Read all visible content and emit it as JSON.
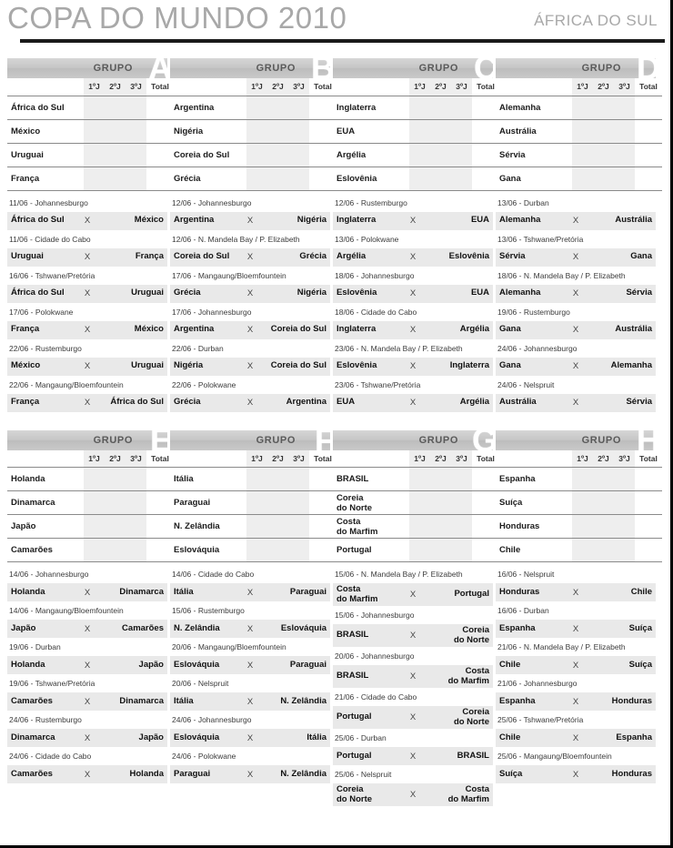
{
  "header": {
    "title": "COPA DO MUNDO 2010",
    "subtitle": "ÁFRICA DO SUL"
  },
  "labels": {
    "grupo": "GRUPO",
    "vs": "X",
    "columns": [
      "1ºJ",
      "2ºJ",
      "3ºJ",
      "Total"
    ]
  },
  "groups": [
    {
      "letter": "A",
      "teams": [
        "África do Sul",
        "México",
        "Uruguai",
        "França"
      ],
      "matches": [
        {
          "venue": "11/06 - Johannesburgo",
          "home": "África do Sul",
          "away": "México"
        },
        {
          "venue": "11/06 - Cidade do Cabo",
          "home": "Uruguai",
          "away": "França"
        },
        {
          "venue": "16/06 - Tshwane/Pretória",
          "home": "África do Sul",
          "away": "Uruguai"
        },
        {
          "venue": "17/06 - Polokwane",
          "home": "França",
          "away": "México"
        },
        {
          "venue": "22/06 - Rustemburgo",
          "home": "México",
          "away": "Uruguai"
        },
        {
          "venue": "22/06 - Mangaung/Bloemfountein",
          "home": "França",
          "away": "África do Sul"
        }
      ]
    },
    {
      "letter": "B",
      "teams": [
        "Argentina",
        "Nigéria",
        "Coreia do Sul",
        "Grécia"
      ],
      "matches": [
        {
          "venue": "12/06 - Johannesburgo",
          "home": "Argentina",
          "away": "Nigéria"
        },
        {
          "venue": "12/06 - N. Mandela Bay / P. Elizabeth",
          "home": "Coreia do Sul",
          "away": "Grécia"
        },
        {
          "venue": "17/06 - Mangaung/Bloemfountein",
          "home": "Grécia",
          "away": "Nigéria"
        },
        {
          "venue": "17/06 - Johannesburgo",
          "home": "Argentina",
          "away": "Coreia do Sul"
        },
        {
          "venue": "22/06 - Durban",
          "home": "Nigéria",
          "away": "Coreia do Sul"
        },
        {
          "venue": "22/06 - Polokwane",
          "home": "Grécia",
          "away": "Argentina"
        }
      ]
    },
    {
      "letter": "C",
      "teams": [
        "Inglaterra",
        "EUA",
        "Argélia",
        "Eslovênia"
      ],
      "matches": [
        {
          "venue": "12/06 - Rustemburgo",
          "home": "Inglaterra",
          "away": "EUA"
        },
        {
          "venue": "13/06 - Polokwane",
          "home": "Argélia",
          "away": "Eslovênia"
        },
        {
          "venue": "18/06 - Johannesburgo",
          "home": "Eslovênia",
          "away": "EUA"
        },
        {
          "venue": "18/06 - Cidade do Cabo",
          "home": "Inglaterra",
          "away": "Argélia"
        },
        {
          "venue": "23/06 - N. Mandela Bay / P. Elizabeth",
          "home": "Eslovênia",
          "away": "Inglaterra"
        },
        {
          "venue": "23/06 - Tshwane/Pretória",
          "home": "EUA",
          "away": "Argélia"
        }
      ]
    },
    {
      "letter": "D",
      "teams": [
        "Alemanha",
        "Austrália",
        "Sérvia",
        "Gana"
      ],
      "matches": [
        {
          "venue": "13/06 - Durban",
          "home": "Alemanha",
          "away": "Austrália"
        },
        {
          "venue": "13/06 - Tshwane/Pretória",
          "home": "Sérvia",
          "away": "Gana"
        },
        {
          "venue": "18/06 - N. Mandela Bay / P. Elizabeth",
          "home": "Alemanha",
          "away": "Sérvia"
        },
        {
          "venue": "19/06 - Rustemburgo",
          "home": "Gana",
          "away": "Austrália"
        },
        {
          "venue": "24/06 - Johannesburgo",
          "home": "Gana",
          "away": "Alemanha"
        },
        {
          "venue": "24/06 - Nelspruit",
          "home": "Austrália",
          "away": "Sérvia"
        }
      ]
    },
    {
      "letter": "E",
      "teams": [
        "Holanda",
        "Dinamarca",
        "Japão",
        "Camarões"
      ],
      "matches": [
        {
          "venue": "14/06 - Johannesburgo",
          "home": "Holanda",
          "away": "Dinamarca"
        },
        {
          "venue": "14/06 - Mangaung/Bloemfountein",
          "home": "Japão",
          "away": "Camarões"
        },
        {
          "venue": "19/06 - Durban",
          "home": "Holanda",
          "away": "Japão"
        },
        {
          "venue": "19/06 - Tshwane/Pretória",
          "home": "Camarões",
          "away": "Dinamarca"
        },
        {
          "venue": "24/06 - Rustemburgo",
          "home": "Dinamarca",
          "away": "Japão"
        },
        {
          "venue": "24/06 - Cidade do Cabo",
          "home": "Camarões",
          "away": "Holanda"
        }
      ]
    },
    {
      "letter": "F",
      "teams": [
        "Itália",
        "Paraguai",
        "N. Zelândia",
        "Eslováquia"
      ],
      "matches": [
        {
          "venue": "14/06 - Cidade do Cabo",
          "home": "Itália",
          "away": "Paraguai"
        },
        {
          "venue": "15/06 - Rustemburgo",
          "home": "N. Zelândia",
          "away": "Eslováquia"
        },
        {
          "venue": "20/06 - Mangaung/Bloemfountein",
          "home": "Eslováquia",
          "away": "Paraguai"
        },
        {
          "venue": "20/06 - Nelspruit",
          "home": "Itália",
          "away": "N. Zelândia"
        },
        {
          "venue": "24/06 - Johannesburgo",
          "home": "Eslováquia",
          "away": "Itália"
        },
        {
          "venue": "24/06 - Polokwane",
          "home": "Paraguai",
          "away": "N. Zelândia"
        }
      ]
    },
    {
      "letter": "G",
      "teams": [
        "BRASIL",
        "Coreia\ndo Norte",
        "Costa\ndo Marfim",
        "Portugal"
      ],
      "matches": [
        {
          "venue": "15/06 - N. Mandela Bay / P. Elizabeth",
          "home": "Costa\ndo Marfim",
          "away": "Portugal"
        },
        {
          "venue": "15/06 - Johannesburgo",
          "home": "BRASIL",
          "away": "Coreia\ndo Norte"
        },
        {
          "venue": "20/06 - Johannesburgo",
          "home": "BRASIL",
          "away": "Costa\ndo Marfim"
        },
        {
          "venue": "21/06 - Cidade do Cabo",
          "home": "Portugal",
          "away": "Coreia\ndo Norte"
        },
        {
          "venue": "25/06 - Durban",
          "home": "Portugal",
          "away": "BRASIL"
        },
        {
          "venue": "25/06 - Nelspruit",
          "home": "Coreia\ndo Norte",
          "away": "Costa\ndo Marfim"
        }
      ]
    },
    {
      "letter": "H",
      "teams": [
        "Espanha",
        "Suíça",
        "Honduras",
        "Chile"
      ],
      "matches": [
        {
          "venue": "16/06 - Nelspruit",
          "home": "Honduras",
          "away": "Chile"
        },
        {
          "venue": "16/06 - Durban",
          "home": "Espanha",
          "away": "Suíça"
        },
        {
          "venue": "21/06 - N. Mandela Bay / P. Elizabeth",
          "home": "Chile",
          "away": "Suíça"
        },
        {
          "venue": "21/06 - Johannesburgo",
          "home": "Espanha",
          "away": "Honduras"
        },
        {
          "venue": "25/06 - Tshwane/Pretória",
          "home": "Chile",
          "away": "Espanha"
        },
        {
          "venue": "25/06 - Mangaung/Bloemfountein",
          "home": "Suíça",
          "away": "Honduras"
        }
      ]
    }
  ]
}
